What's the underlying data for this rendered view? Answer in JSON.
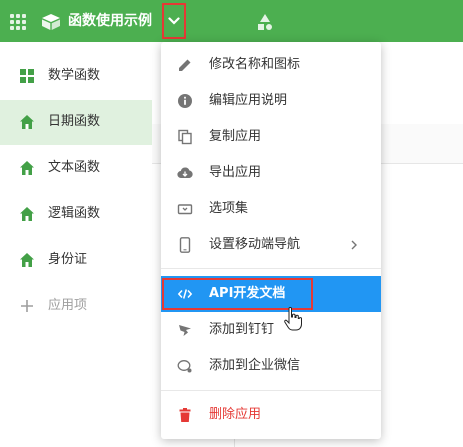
{
  "header": {
    "app_title": "函数使用示例",
    "icons": [
      "grid-icon",
      "app-cube-icon",
      "chevron-down-icon",
      "shapes-icon"
    ],
    "color": "#4caf50"
  },
  "sidebar": {
    "items": [
      {
        "label": "数学函数",
        "icon": "table-grid-icon",
        "active": false
      },
      {
        "label": "日期函数",
        "icon": "home-icon",
        "active": true
      },
      {
        "label": "文本函数",
        "icon": "home-icon",
        "active": false
      },
      {
        "label": "逻辑函数",
        "icon": "home-icon",
        "active": false
      },
      {
        "label": "身份证",
        "icon": "home-icon",
        "active": false
      },
      {
        "label": "应用项",
        "icon": "plus-icon",
        "active": false
      }
    ]
  },
  "menu": {
    "items": [
      {
        "label": "修改名称和图标",
        "icon": "pencil-icon"
      },
      {
        "label": "编辑应用说明",
        "icon": "info-icon"
      },
      {
        "label": "复制应用",
        "icon": "copy-icon"
      },
      {
        "label": "导出应用",
        "icon": "cloud-download-icon"
      },
      {
        "label": "选项集",
        "icon": "option-set-icon"
      },
      {
        "label": "设置移动端导航",
        "icon": "mobile-icon",
        "submenu": true
      },
      {
        "label": "API开发文档",
        "icon": "code-icon",
        "highlighted": true
      },
      {
        "label": "添加到钉钉",
        "icon": "dingtalk-icon"
      },
      {
        "label": "添加到企业微信",
        "icon": "wecom-icon"
      },
      {
        "label": "删除应用",
        "icon": "trash-icon",
        "danger": true
      }
    ],
    "highlight_color": "#2196f3",
    "danger_color": "#e53935"
  }
}
